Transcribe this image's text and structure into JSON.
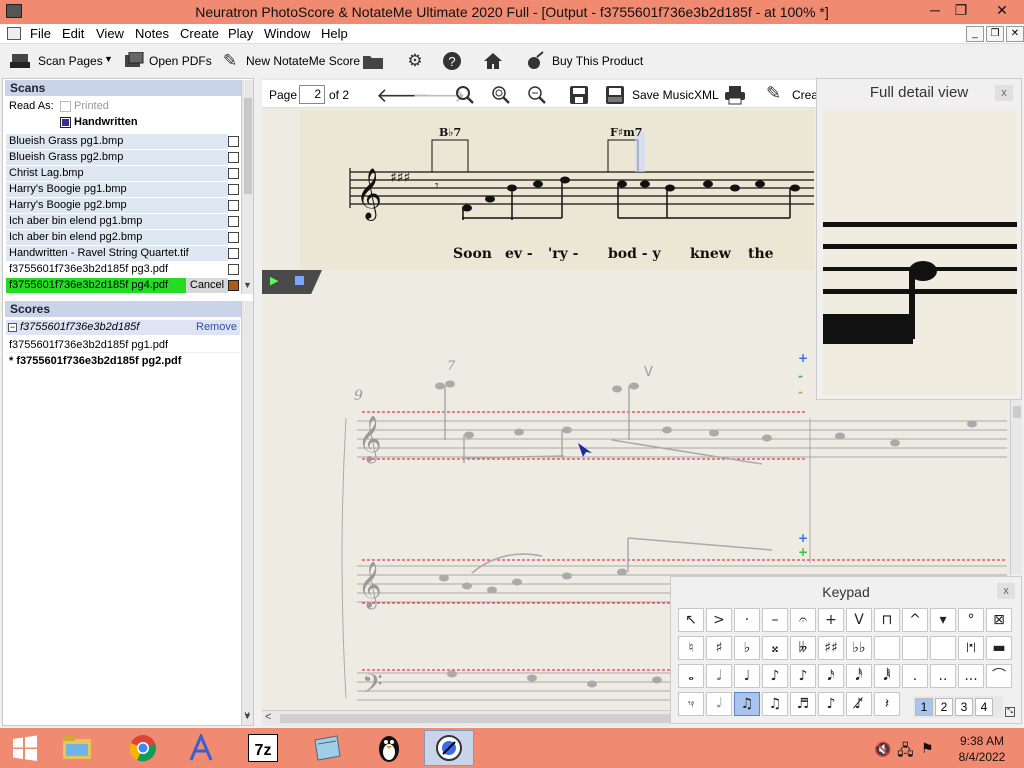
{
  "window": {
    "title": "Neuratron PhotoScore & NotateMe Ultimate 2020 Full - [Output - f3755601f736e3b2d185f - at 100% *]",
    "minimize": "─",
    "restore": "❐",
    "close": "✕"
  },
  "menu": [
    "File",
    "Edit",
    "View",
    "Notes",
    "Create",
    "Play",
    "Window",
    "Help"
  ],
  "mdi": {
    "minimize": "_",
    "restore": "❐",
    "close": "✕"
  },
  "toolbar": {
    "scan_pages": "Scan Pages",
    "open_pdfs": "Open PDFs",
    "new_notateme": "New NotateMe Score",
    "buy": "Buy This Product"
  },
  "scans": {
    "header": "Scans",
    "read_as": "Read As:",
    "printed": "Printed",
    "handwritten": "Handwritten",
    "items": [
      "Blueish Grass pg1.bmp",
      "Blueish Grass pg2.bmp",
      "Christ Lag.bmp",
      "Harry's Boogie pg1.bmp",
      "Harry's Boogie pg2.bmp",
      "Ich aber bin elend pg1.bmp",
      "Ich aber bin elend pg2.bmp",
      "Handwritten - Ravel String Quartet.tif",
      "f3755601f736e3b2d185f pg3.pdf",
      "f3755601f736e3b2d185f pg4.pdf"
    ],
    "cancel": "Cancel"
  },
  "scores": {
    "header": "Scores",
    "group": "f3755601f736e3b2d185f",
    "remove": "Remove",
    "items": [
      "f3755601f736e3b2d185f pg1.pdf",
      "* f3755601f736e3b2d185f pg2.pdf"
    ]
  },
  "pagebar": {
    "page_label": "Page",
    "page_value": "2",
    "of_label": "of 2",
    "save_xml": "Save MusicXML",
    "create": "Crea"
  },
  "score": {
    "chords": [
      "B♭7",
      "F♯m7"
    ],
    "lyrics": [
      "Soon",
      "ev -",
      "'ry -",
      "bod - y",
      "knew",
      "the"
    ],
    "measure_number": "9"
  },
  "detail": {
    "title": "Full detail view",
    "close": "x"
  },
  "keypad": {
    "title": "Keypad",
    "close": "x",
    "rows": [
      [
        "↖",
        ">",
        "·",
        "–",
        "𝄐",
        "+",
        "V",
        "⊓",
        "^",
        "▾",
        "°",
        "⊠"
      ],
      [
        "♮",
        "♯",
        "♭",
        "𝄪",
        "𝄫",
        "♯♯",
        "♭♭",
        "",
        "",
        "",
        "|𝄺|",
        "▬"
      ],
      [
        "𝅝",
        "𝅗𝅥",
        "♩",
        "♪",
        "♪",
        "𝅘𝅥𝅯",
        "𝅘𝅥𝅰",
        "𝅘𝅥𝅱",
        ".",
        "..",
        "...",
        "⌒"
      ],
      [
        "𝄾𝄿",
        "𝆹𝅥",
        "♫",
        "♫",
        "♬",
        "♪",
        "♪̸",
        "𝄽"
      ]
    ],
    "pages": [
      "1",
      "2",
      "3",
      "4"
    ]
  },
  "tray": {
    "time": "9:38 AM",
    "date": "8/4/2022"
  },
  "colors": {
    "accent": "#f08a70",
    "progress": "#22dd22",
    "selection": "#a9c4ee"
  }
}
